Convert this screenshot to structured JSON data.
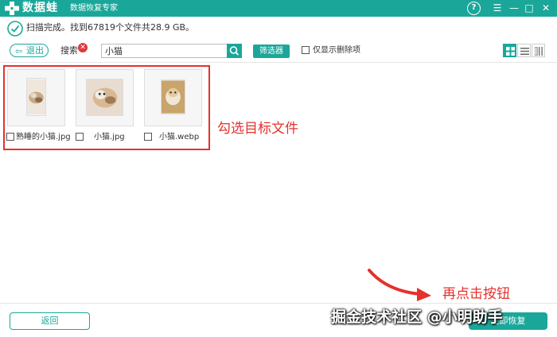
{
  "titlebar": {
    "app_name": "数据蛙",
    "subtitle": "数据恢复专家",
    "help": "?",
    "menu": "☰",
    "minimize": "—",
    "maximize": "□",
    "close": "✕",
    "color": "#1aa79a"
  },
  "status": {
    "text": "扫描完成。找到67819个文件共28.9 GB。"
  },
  "toolbar": {
    "back_label": "退出",
    "search_label": "搜索",
    "search_value": "小猫",
    "filter_label": "筛选器",
    "only_deleted_label": "仅显示删除项",
    "view_modes": [
      "grid-view-icon",
      "list-view-icon",
      "detail-view-icon"
    ],
    "active_view": "grid-view-icon"
  },
  "files": [
    {
      "name": "熟睡的小猫.jpg",
      "checked": false
    },
    {
      "name": "小猫.jpg",
      "checked": false
    },
    {
      "name": "小猫.webp",
      "checked": false
    }
  ],
  "annotations": {
    "select_target": "勾选目标文件",
    "click_button": "再点击按钮",
    "color": "#e5312c"
  },
  "footer": {
    "return_label": "返回",
    "recover_label": "立即恢复"
  },
  "watermark": "掘金技术社区 @小明助手"
}
